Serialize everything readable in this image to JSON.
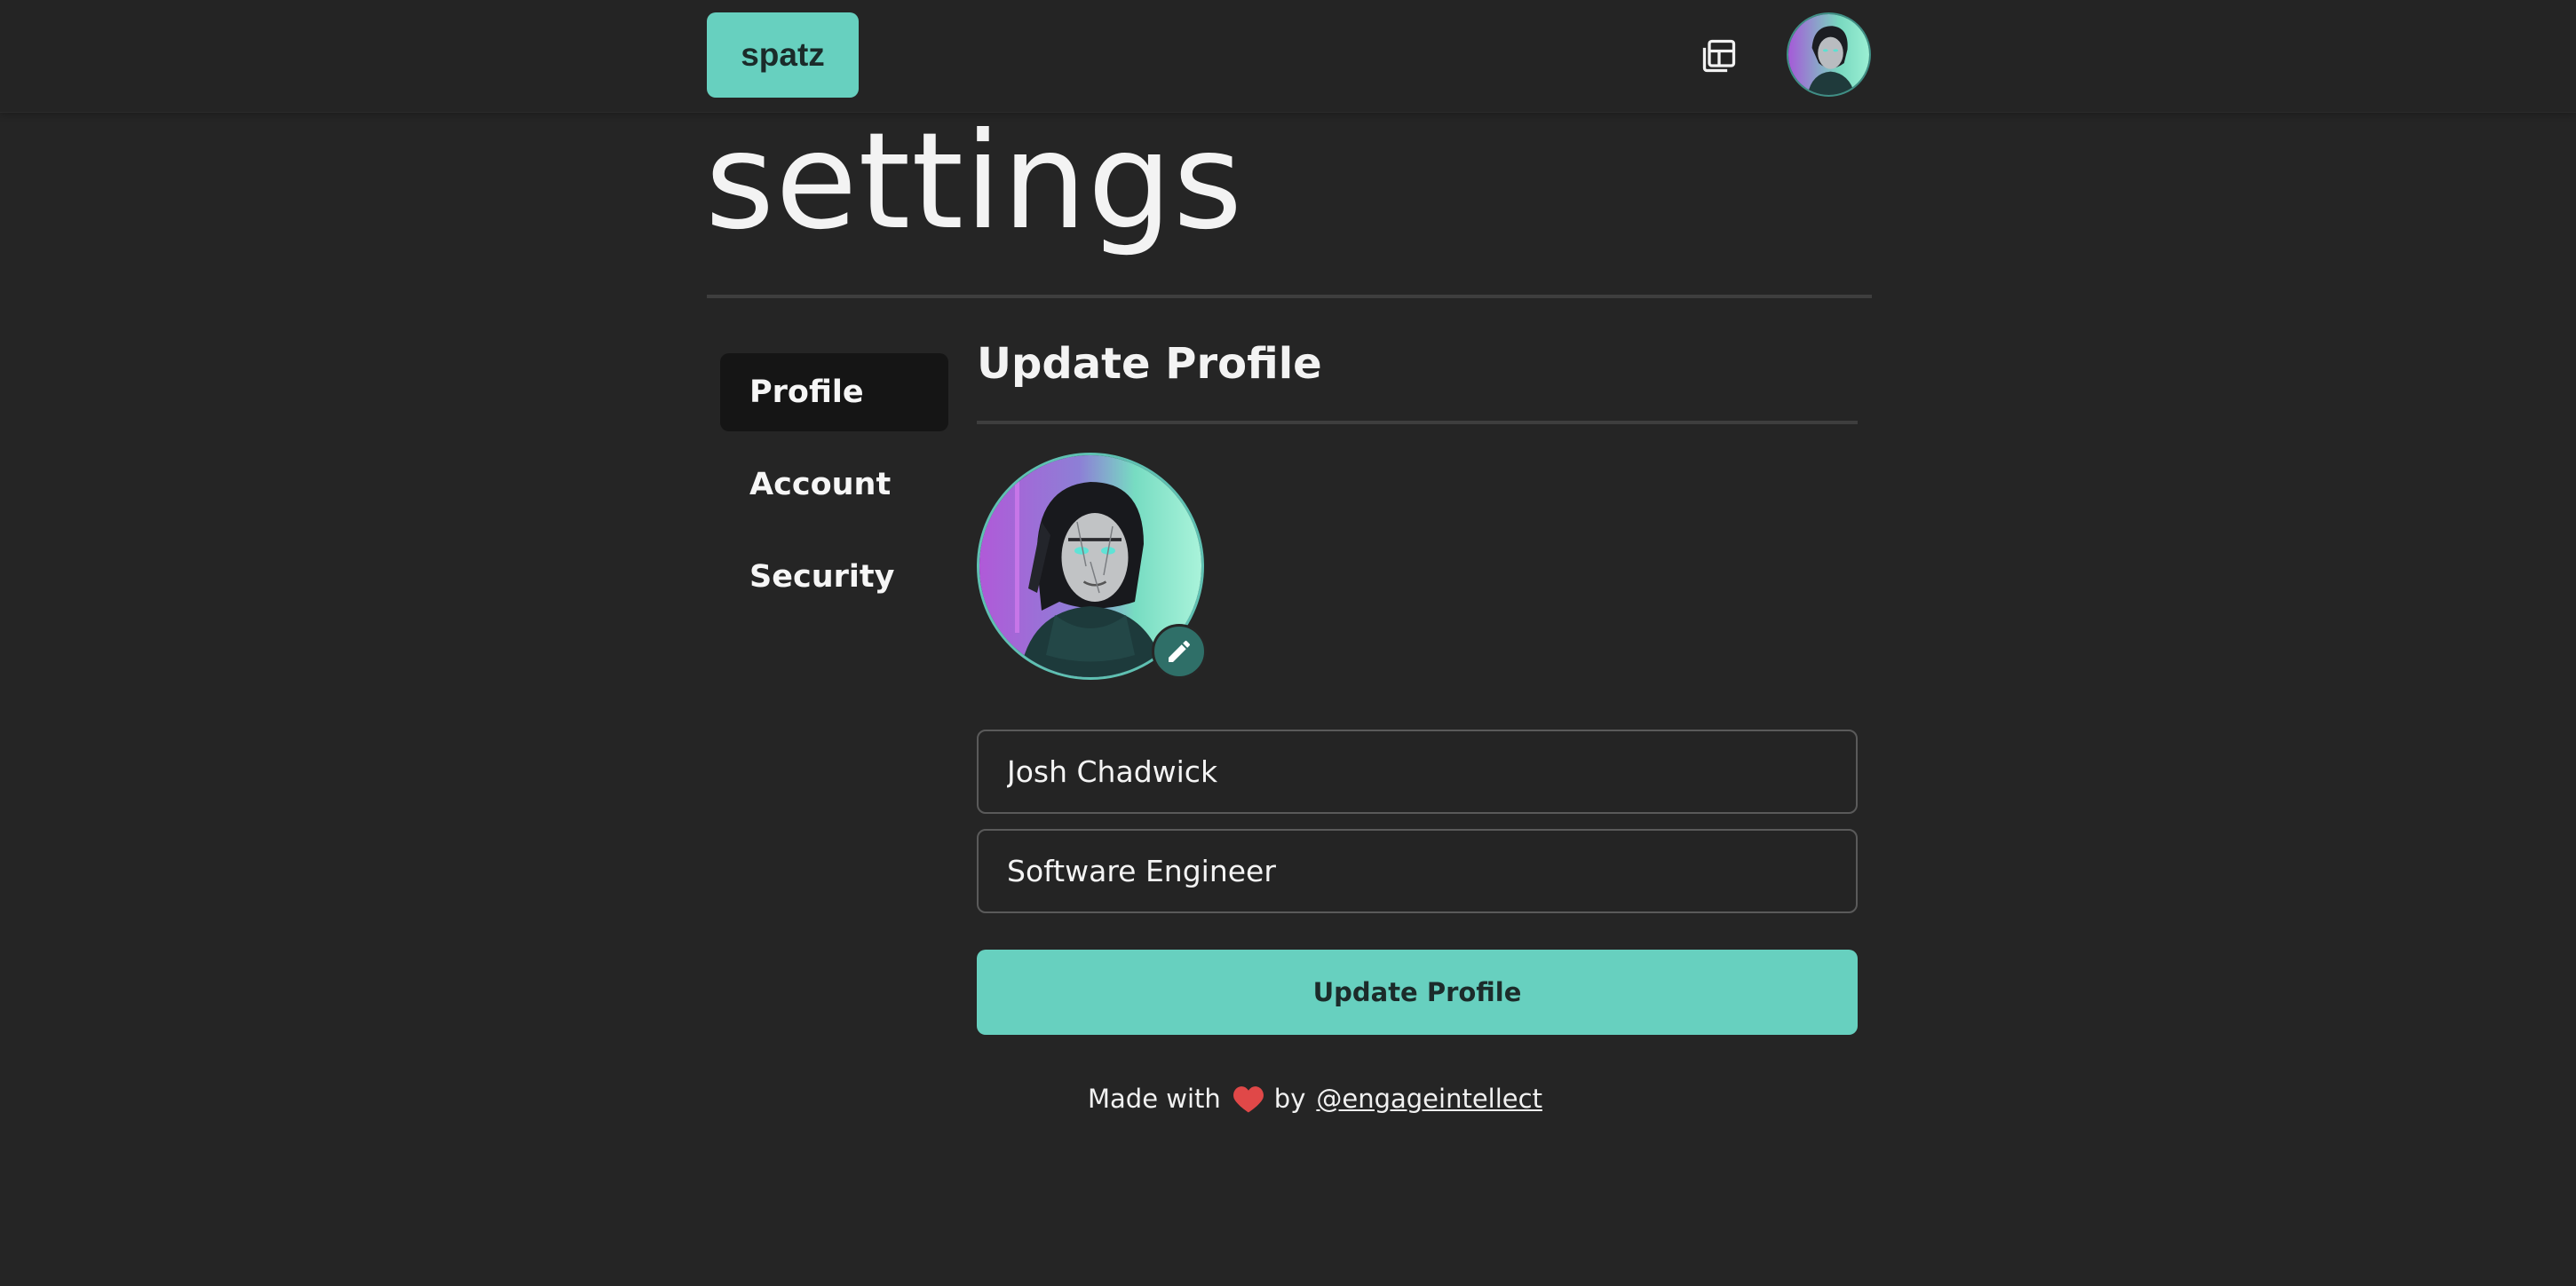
{
  "header": {
    "logo_label": "spatz",
    "icons": {
      "app_switch": "window-stack-icon",
      "avatar": "user-avatar"
    }
  },
  "page": {
    "title": "settings"
  },
  "sidebar": {
    "items": [
      {
        "label": "Profile",
        "active": true
      },
      {
        "label": "Account",
        "active": false
      },
      {
        "label": "Security",
        "active": false
      }
    ]
  },
  "profile": {
    "section_title": "Update Profile",
    "name_value": "Josh Chadwick",
    "title_value": "Software Engineer",
    "submit_label": "Update Profile"
  },
  "footer": {
    "made_with": "Made with",
    "by": "by",
    "handle": "@engageintellect"
  },
  "colors": {
    "accent": "#67d0bf",
    "background": "#252525",
    "heart": "#e04848"
  }
}
